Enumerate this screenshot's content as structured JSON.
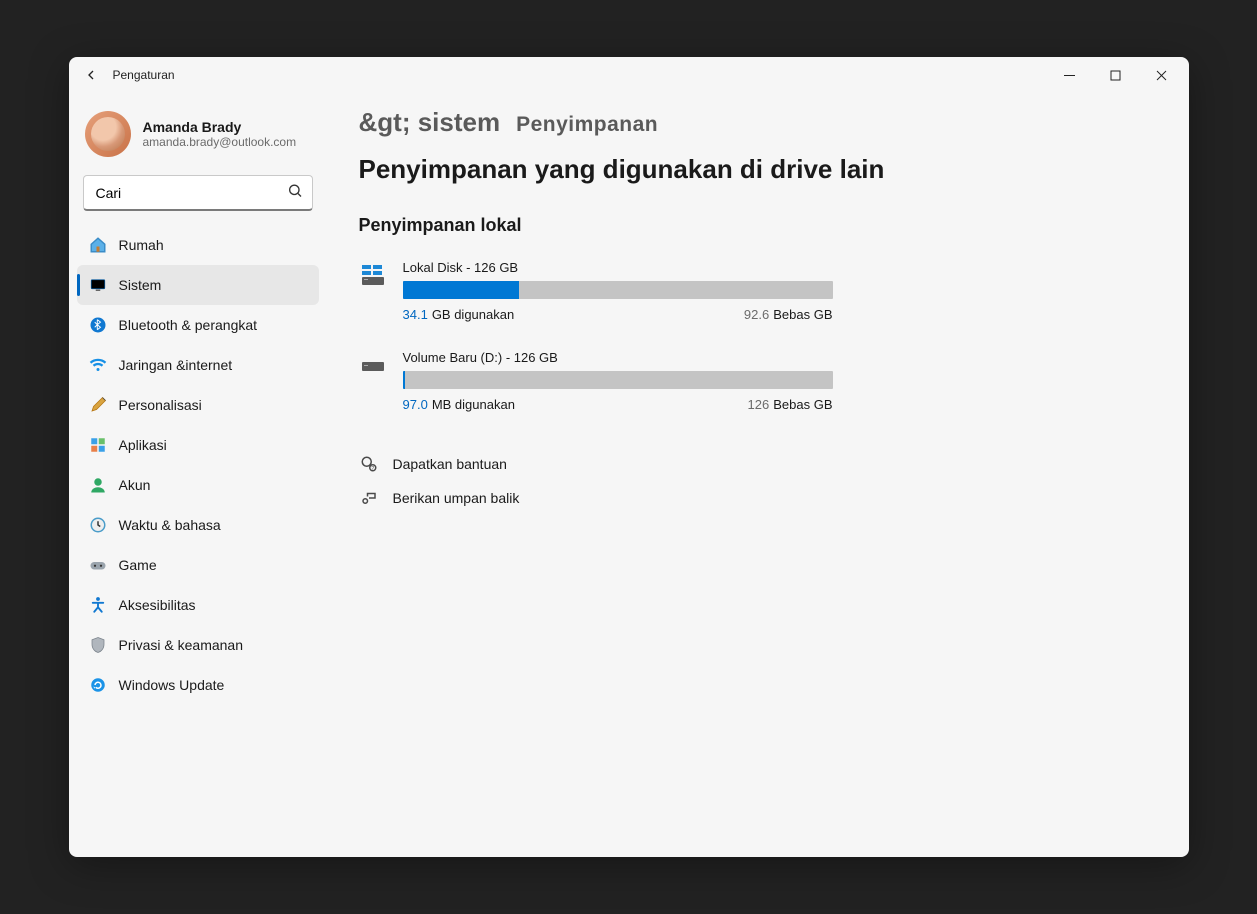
{
  "window": {
    "title": "Pengaturan"
  },
  "profile": {
    "name": "Amanda Brady",
    "email": "amanda.brady@outlook.com"
  },
  "search": {
    "placeholder": "",
    "value": "Cari"
  },
  "sidebar": {
    "items": [
      {
        "id": "home",
        "label": "Rumah"
      },
      {
        "id": "system",
        "label": "Sistem"
      },
      {
        "id": "bluetooth",
        "label": "Bluetooth &amp; perangkat"
      },
      {
        "id": "network",
        "label": "Jaringan &amp;internet"
      },
      {
        "id": "personalize",
        "label": "Personalisasi"
      },
      {
        "id": "apps",
        "label": "Aplikasi"
      },
      {
        "id": "accounts",
        "label": "Akun"
      },
      {
        "id": "time",
        "label": "Waktu &amp; bahasa"
      },
      {
        "id": "gaming",
        "label": "Game"
      },
      {
        "id": "access",
        "label": "Aksesibilitas"
      },
      {
        "id": "privacy",
        "label": "Privasi &amp; keamanan"
      },
      {
        "id": "update",
        "label": "Windows Update"
      }
    ],
    "active_index": 1
  },
  "breadcrumb": {
    "system": "&gt; sistem",
    "storage": "Penyimpanan",
    "page": "Penyimpanan yang digunakan di drive lain"
  },
  "section": {
    "local_storage_title": "Penyimpanan lokal"
  },
  "drives": [
    {
      "name": "Lokal Disk - 126 GB",
      "used_value": "34.1",
      "used_label": "GB digunakan",
      "free_value": "92.6",
      "free_label": "Bebas GB",
      "fill_percent": 27
    },
    {
      "name": "Volume Baru (D:) - 126 GB",
      "used_value": "97.0",
      "used_label": "MB digunakan",
      "free_value": "126",
      "free_label": "Bebas GB",
      "fill_percent": 0.5
    }
  ],
  "links": {
    "get_help": "Dapatkan bantuan",
    "feedback": "Berikan umpan balik"
  }
}
